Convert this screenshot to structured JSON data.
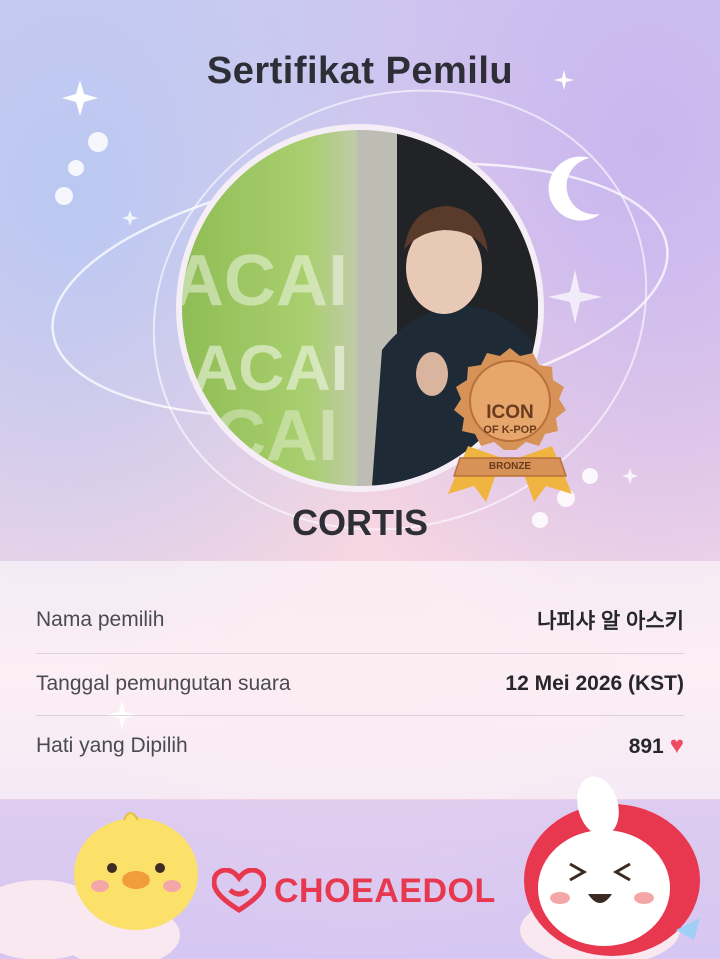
{
  "title": "Sertifikat Pemilu",
  "photo": {
    "watermark": "ACAI"
  },
  "badge": {
    "line1": "ICON",
    "line2": "OF K-POP",
    "tier": "BRONZE",
    "color": "#d69257"
  },
  "artist": "CORTIS",
  "info": {
    "voter_label": "Nama pemilih",
    "voter_value": "나피샤 알 아스키",
    "date_label": "Tanggal pemungutan suara",
    "date_value": "12 Mei 2026 (KST)",
    "hearts_label": "Hati yang Dipilih",
    "hearts_value": "891"
  },
  "footer": {
    "brand": "CHOEAEDOL",
    "brand_color": "#e8384f"
  },
  "icons": [
    "heart-icon",
    "moon-icon",
    "sparkle-icon",
    "choeaedol-logo-icon",
    "chick-mascot",
    "bunny-mascot"
  ]
}
